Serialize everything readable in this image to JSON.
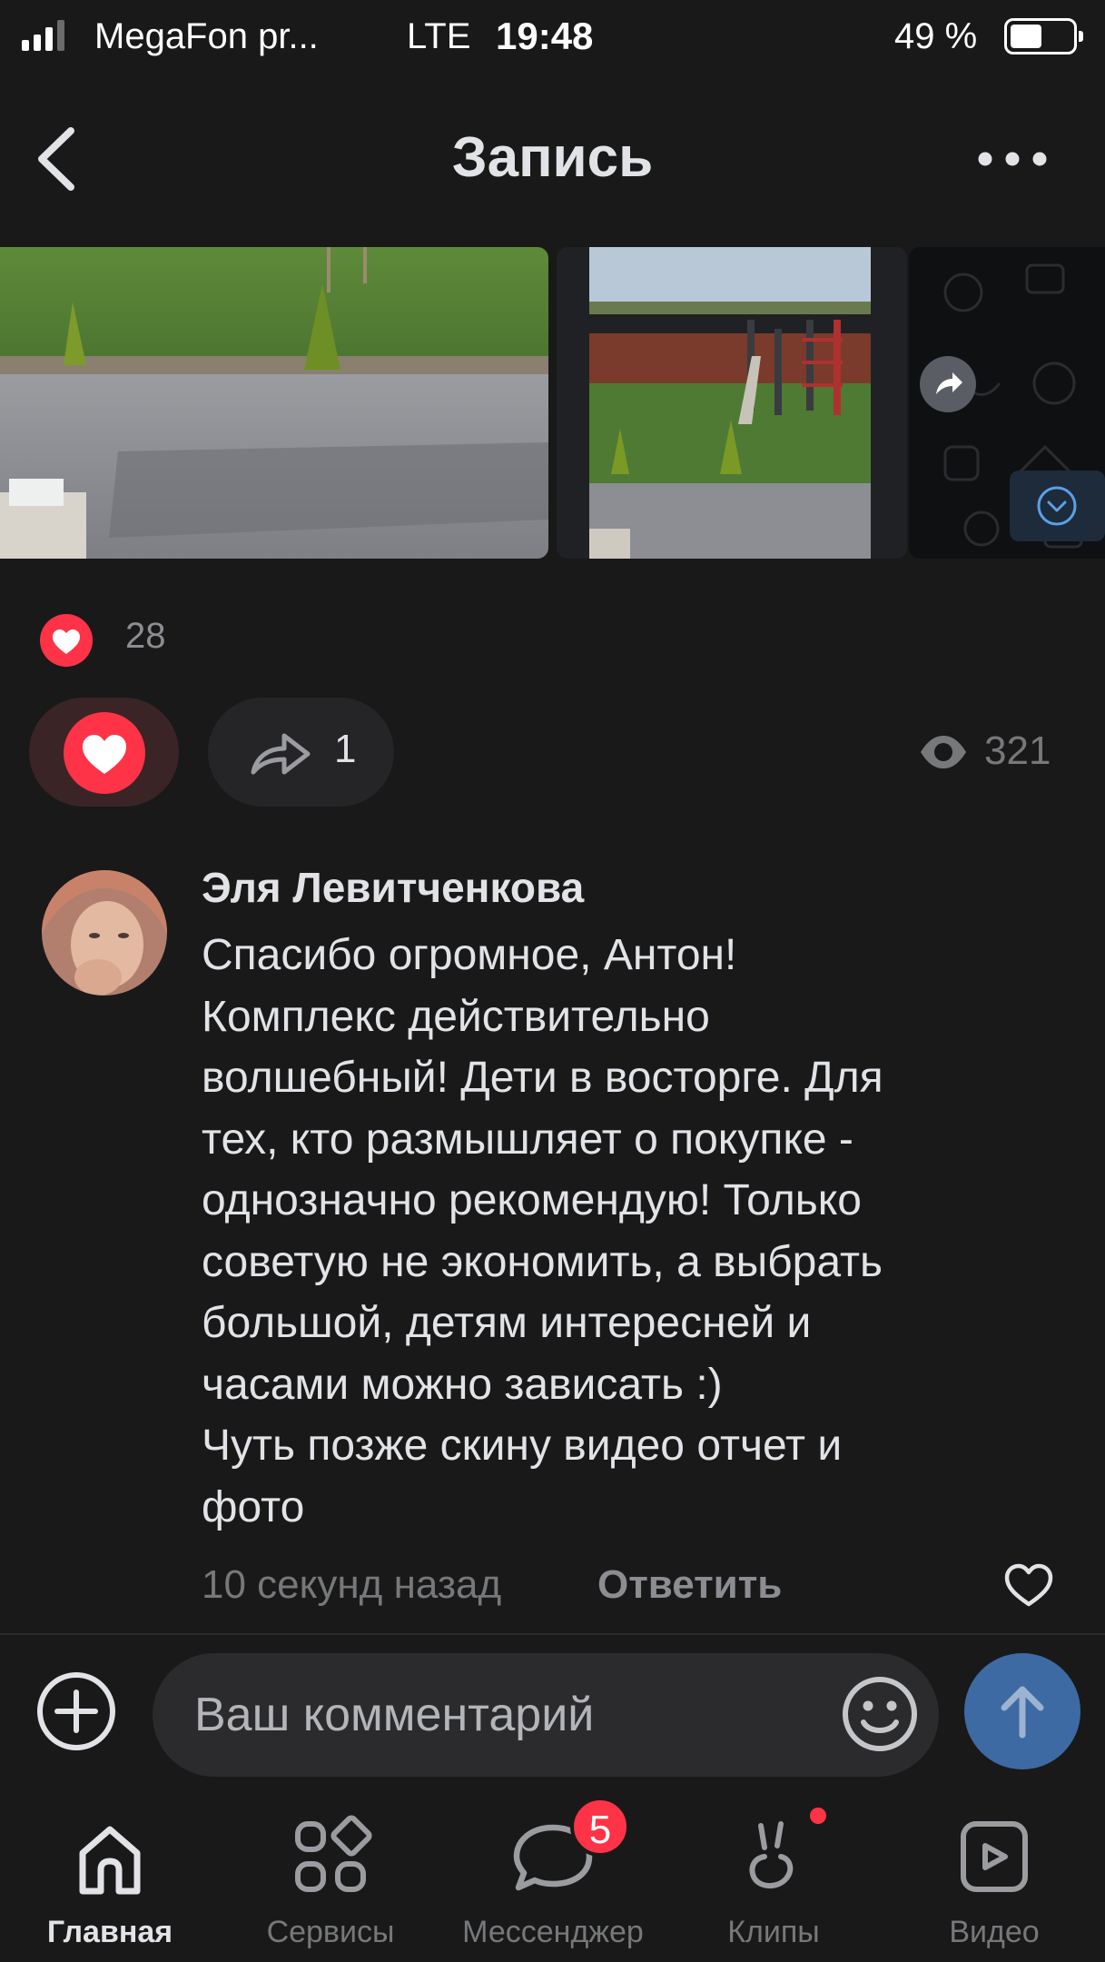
{
  "status_bar": {
    "carrier": "MegaFon pr...",
    "network": "LTE",
    "time": "19:48",
    "battery": "49 %",
    "battery_level": 0.49
  },
  "header": {
    "title": "Запись",
    "back_icon": "chevron-left-icon",
    "more_icon": "more-horizontal-icon"
  },
  "post": {
    "likes_count": "28",
    "shares_count": "1",
    "views_count": "321",
    "liked": true
  },
  "comment": {
    "author": "Эля Левитченкова",
    "text_lines": [
      "Спасибо огромное, Антон!",
      "Комплекс действительно",
      "волшебный! Дети в восторге. Для",
      "тех, кто размышляет о покупке -",
      "однозначно рекомендую! Только",
      "советую не экономить, а выбрать",
      "большой, детям интересней и",
      "часами можно зависать :)",
      "Чуть позже скину видео отчет и",
      "фото"
    ],
    "time": "10 секунд назад",
    "reply_label": "Ответить"
  },
  "composer": {
    "placeholder": "Ваш комментарий"
  },
  "tabbar": {
    "items": [
      {
        "label": "Главная",
        "icon": "home-icon",
        "active": true
      },
      {
        "label": "Сервисы",
        "icon": "services-icon",
        "active": false
      },
      {
        "label": "Мессенджер",
        "icon": "messenger-icon",
        "active": false,
        "badge": "5"
      },
      {
        "label": "Клипы",
        "icon": "clips-icon",
        "active": false,
        "dot": true
      },
      {
        "label": "Видео",
        "icon": "video-icon",
        "active": false
      }
    ]
  },
  "colors": {
    "background": "#19191a",
    "accent_red": "#ff3347",
    "send_blue": "#3d6aa3",
    "text_primary": "#e1e3e6",
    "text_secondary": "#76787a"
  }
}
